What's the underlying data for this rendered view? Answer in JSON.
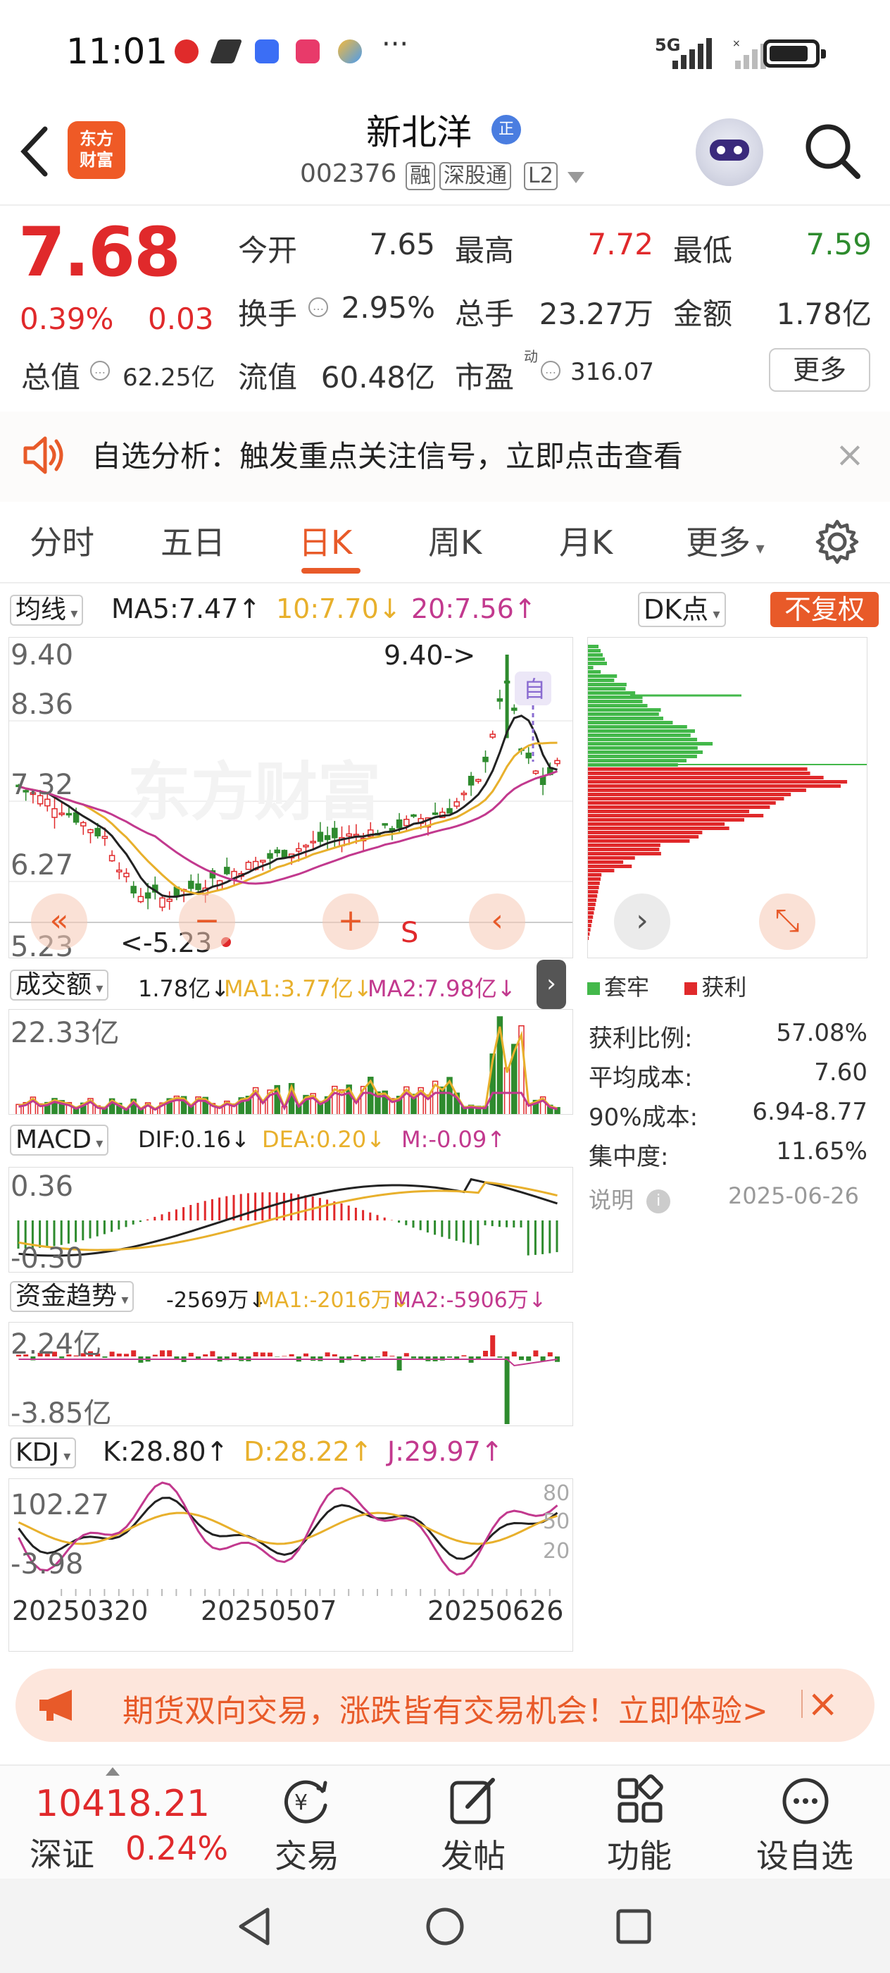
{
  "status_bar": {
    "time": "11:01",
    "network": "5G"
  },
  "header": {
    "logo_text": "东方财富",
    "stock_name": "新北洋",
    "zheng_badge": "正",
    "stock_code": "002376",
    "tags": [
      "融",
      "深股通",
      "L2"
    ]
  },
  "quote": {
    "price": "7.68",
    "change_pct": "0.39%",
    "change": "0.03",
    "items": [
      {
        "label": "今开",
        "value": "7.65"
      },
      {
        "label": "最高",
        "value": "7.72"
      },
      {
        "label": "最低",
        "value": "7.59"
      },
      {
        "label": "换手",
        "value": "2.95%"
      },
      {
        "label": "总手",
        "value": "23.27万"
      },
      {
        "label": "金额",
        "value": "1.78亿"
      },
      {
        "label": "总值",
        "value": "62.25亿"
      },
      {
        "label": "流值",
        "value": "60.48亿"
      },
      {
        "label": "市盈",
        "value": "316.07",
        "sup": "动"
      }
    ],
    "more_button": "更多"
  },
  "banner": {
    "text": "自选分析：触发重点关注信号，立即点击查看",
    "close": "×"
  },
  "tabs": [
    "分时",
    "五日",
    "日K",
    "周K",
    "月K",
    "更多"
  ],
  "active_tab": "日K",
  "ma_row": {
    "selector": "均线",
    "ma5": "MA5:7.47↑",
    "ma10": "10:7.70↓",
    "ma20": "20:7.56↑",
    "dk_button": "DK点",
    "fq_button": "不复权"
  },
  "kline": {
    "y_labels": [
      "9.40",
      "8.36",
      "7.32",
      "6.27",
      "5.23"
    ],
    "high_annot": "9.40->",
    "low_annot": "<-5.23",
    "marker_zi": "自",
    "marker_s": "S",
    "buttons": {
      "prev": "«",
      "minus": "−",
      "plus": "+",
      "back": "‹",
      "next": "›",
      "expand": "⤡"
    }
  },
  "volume_row": {
    "selector": "成交额",
    "val": "1.78亿↓",
    "ma1": "MA1:3.77亿↓",
    "ma2": "MA2:7.98亿↓",
    "y_top": "22.33亿"
  },
  "macd_row": {
    "selector": "MACD",
    "dif": "DIF:0.16↓",
    "dea": "DEA:0.20↓",
    "m": "M:-0.09↑",
    "y_top": "0.36",
    "y_bot": "-0.30"
  },
  "fund_row": {
    "selector": "资金趋势",
    "val": "-2569万↓",
    "ma1": "MA1:-2016万↓",
    "ma2": "MA2:-5906万↓",
    "y_top": "2.24亿",
    "y_bot": "-3.85亿"
  },
  "kdj_row": {
    "selector": "KDJ",
    "k": "K:28.80↑",
    "d": "D:28.22↑",
    "j": "J:29.97↑",
    "y_top": "102.27",
    "y_bot": "-3.98",
    "levels": [
      "80",
      "50",
      "20"
    ]
  },
  "dates": [
    "20250320",
    "20250507",
    "20250626"
  ],
  "chips": {
    "legend": [
      "套牢",
      "获利"
    ],
    "stats": [
      {
        "label": "获利比例:",
        "value": "57.08%"
      },
      {
        "label": "平均成本:",
        "value": "7.60"
      },
      {
        "label": "90%成本:",
        "value": "6.94-8.77"
      },
      {
        "label": "集中度:",
        "value": "11.65%"
      }
    ],
    "note_label": "说明",
    "note_date": "2025-06-26"
  },
  "ad": {
    "text": "期货双向交易，涨跌皆有交易机会！立即体验>",
    "close": "×"
  },
  "bottom_nav": {
    "index_value": "10418.21",
    "index_name": "深证",
    "index_pct": "0.24%",
    "items": [
      "交易",
      "发帖",
      "功能",
      "设自选"
    ]
  },
  "colors": {
    "up": "#e0292b",
    "down": "#2e8b2e",
    "accent": "#e85a29"
  }
}
